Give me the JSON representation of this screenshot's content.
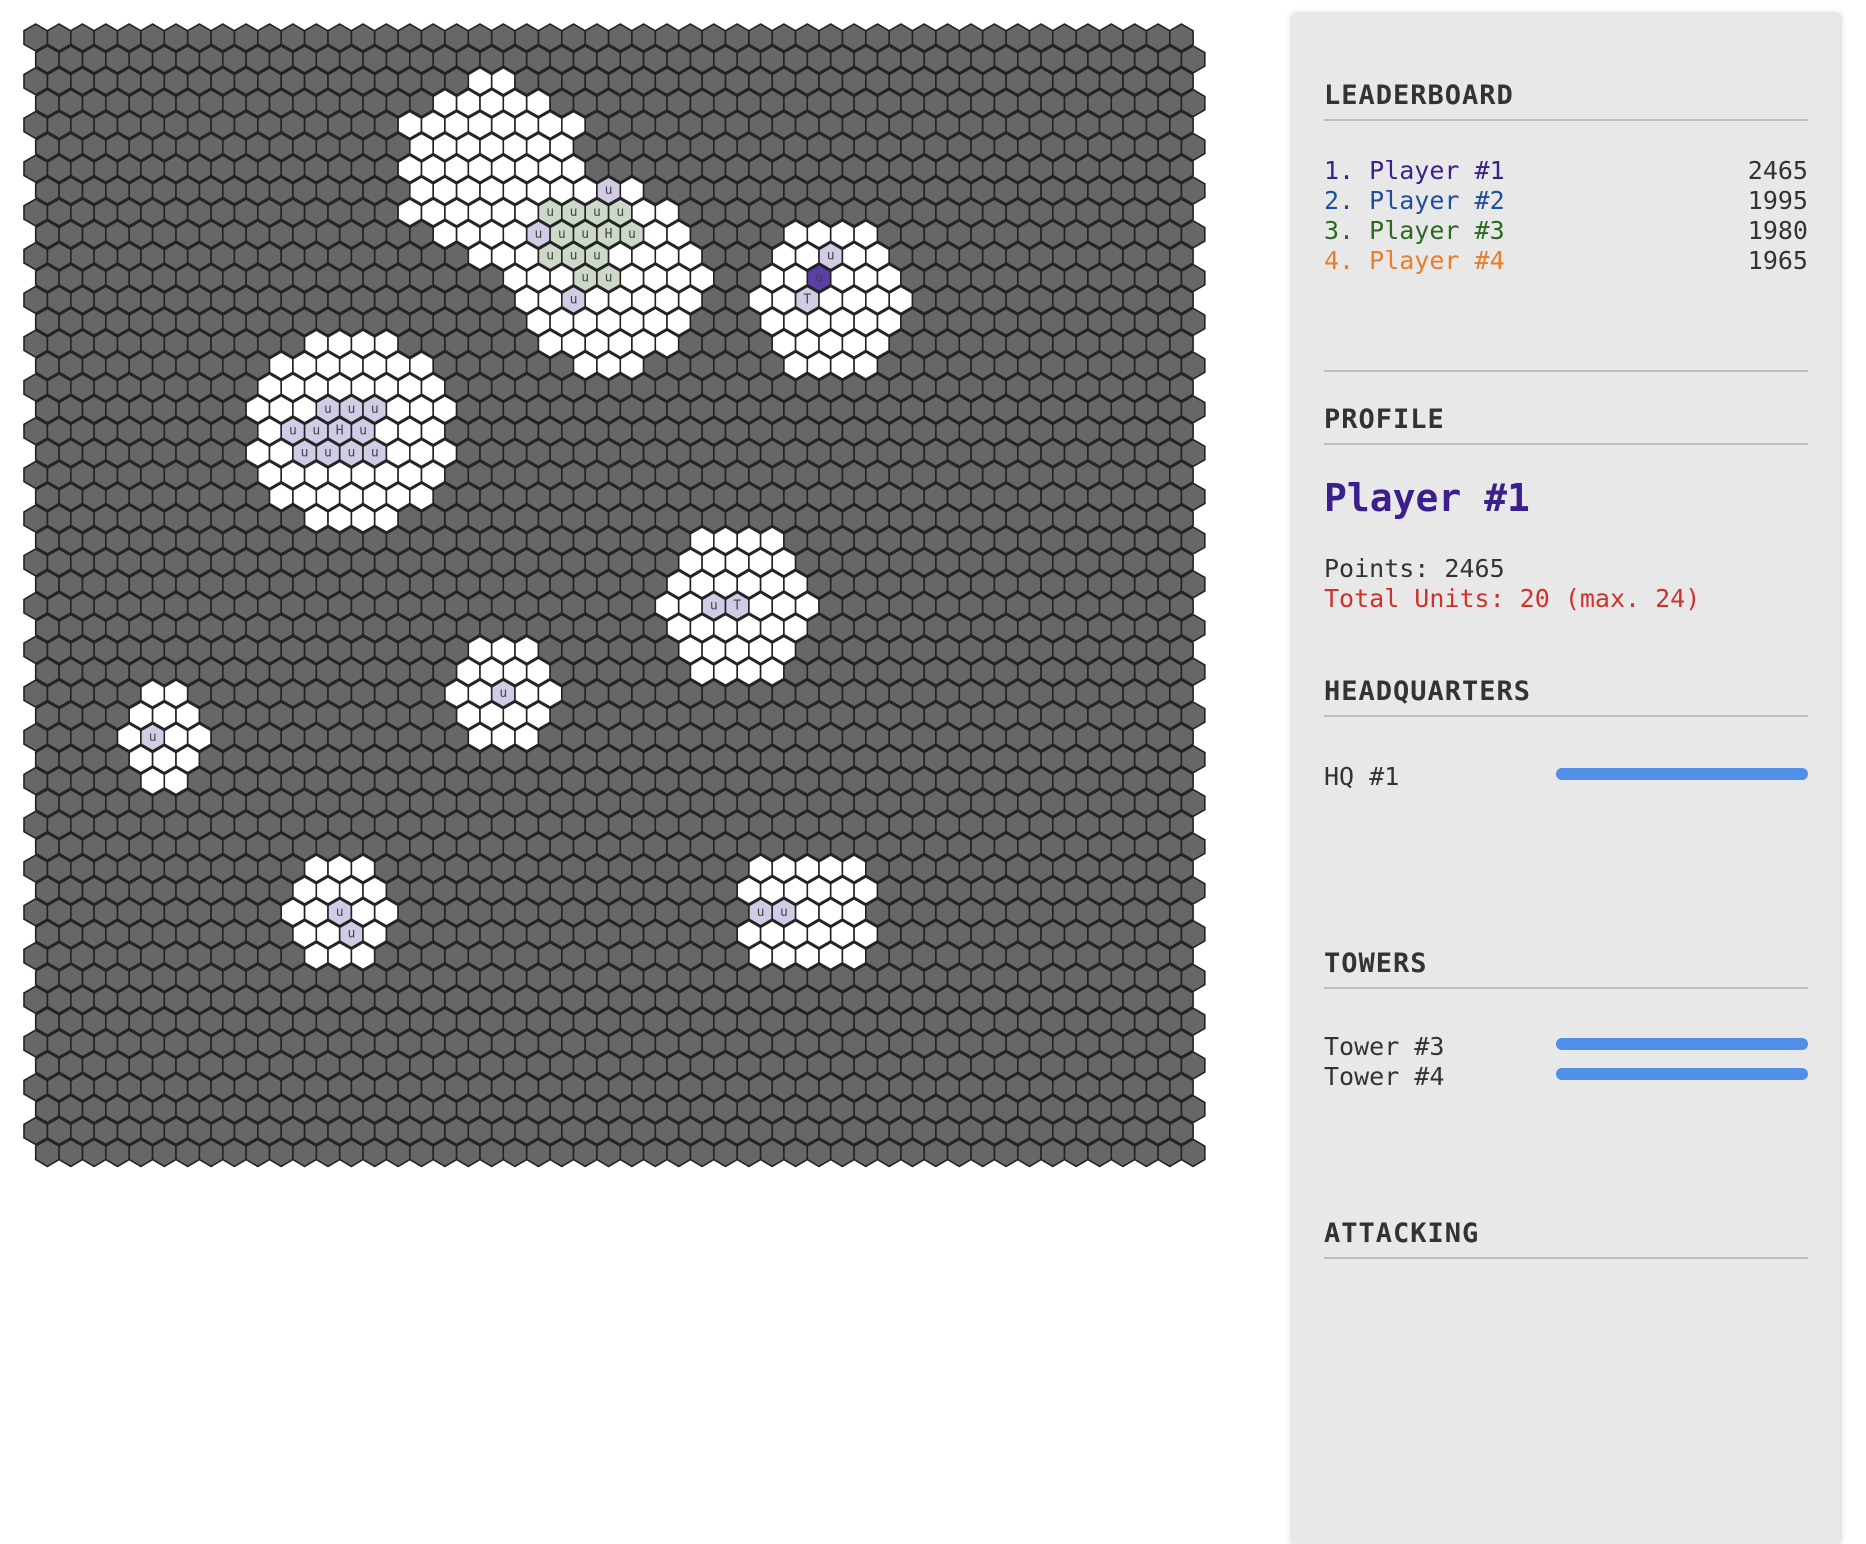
{
  "colors": {
    "empty": "#676767",
    "owned": "#ffffff",
    "unit": "#d2cbe6",
    "self": "#5b3ea6",
    "green": "#cdd9c8",
    "player_colors": [
      "#3b1f8c",
      "#1f4e9e",
      "#2b6a1e",
      "#e87d2a"
    ],
    "bar": "#4f8fe8"
  },
  "leaderboard": {
    "title": "LEADERBOARD",
    "entries": [
      {
        "name": "1. Player #1",
        "score": "2465"
      },
      {
        "name": "2. Player #2",
        "score": "1995"
      },
      {
        "name": "3. Player #3",
        "score": "1980"
      },
      {
        "name": "4. Player #4",
        "score": "1965"
      }
    ]
  },
  "profile": {
    "title": "PROFILE",
    "name": "Player #1",
    "points": "Points: 2465",
    "units": "Total Units: 20 (max. 24)"
  },
  "headquarters": {
    "title": "HEADQUARTERS",
    "items": [
      {
        "label": "HQ #1",
        "health": 1.0
      }
    ]
  },
  "towers": {
    "title": "TOWERS",
    "items": [
      {
        "label": "Tower #3",
        "health": 1.0
      },
      {
        "label": "Tower #4",
        "health": 1.0
      }
    ]
  },
  "attacking": {
    "title": "ATTACKING",
    "items": []
  }
}
